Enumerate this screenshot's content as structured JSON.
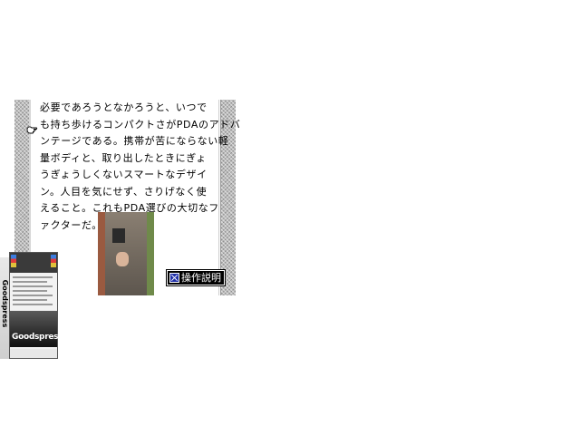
{
  "reader": {
    "lines": [
      "必要であろうとなかろうと、いつで",
      "も持ち歩けるコンパクトさがPDAのアドバ",
      "ンテージである。携帯が苦にならない軽",
      "量ボディと、取り出したときにぎょ",
      "うぎょうしくないスマートなデザイ",
      "ン。人目を気にせず、さりげなく使",
      "えること。これもPDA選びの大切なフ",
      "ァクターだ。"
    ],
    "help_button_label": "操作説明"
  },
  "icons": {
    "pointer": "hand-pointer-icon",
    "help": "x-icon"
  },
  "box": {
    "title": "Goodspress",
    "spine_text": "Goodspress"
  },
  "colors": {
    "help_icon_bg": "#1f2fa8",
    "border_pattern": "#bdbdbd"
  }
}
